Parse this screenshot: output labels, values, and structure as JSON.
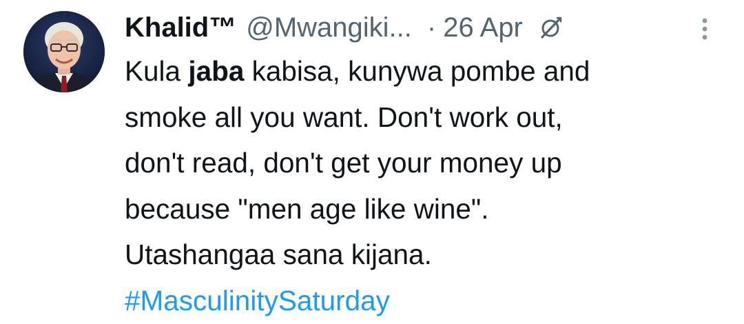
{
  "tweet": {
    "author": {
      "display_name": "Khalid™",
      "handle": "@Mwangiki...",
      "avatar_icon": "avatar-photo"
    },
    "separator": "·",
    "date": "26 Apr",
    "edited_icon": "edit-pencil-icon",
    "more_icon": "vertical-ellipsis-icon",
    "body": {
      "line1_prefix": "Kula ",
      "line1_bold": "jaba",
      "line1_suffix": " kabisa, kunywa pombe and",
      "line2": "smoke all you want. Don't work out,",
      "line3": "don't read, don't get your money up",
      "line4": "because \"men age like wine\".",
      "line5": "Utashangaa sana kijana.",
      "hashtag": "#MasculinitySaturday"
    },
    "colors": {
      "text": "#0f1419",
      "secondary": "#536471",
      "link": "#1d9bf0"
    }
  }
}
